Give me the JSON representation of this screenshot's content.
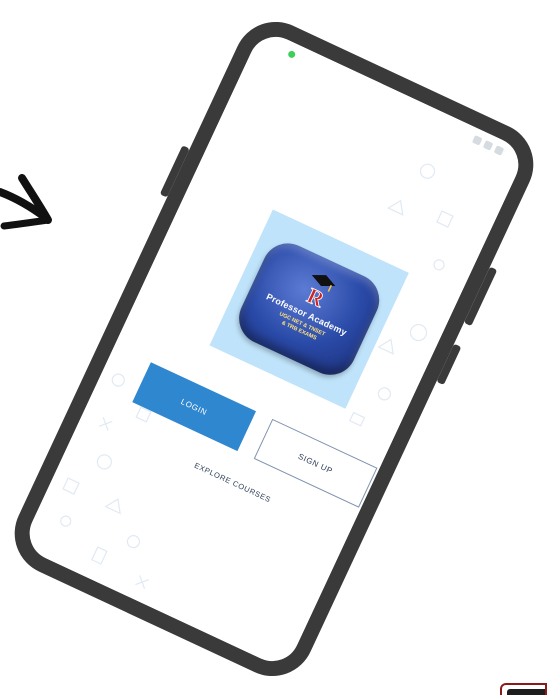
{
  "logo": {
    "name": "Professor Academy",
    "tagline_line1": "UGC NET & TNSET",
    "tagline_line2": "& TRB EXAMS",
    "monogram": "PR",
    "background_color": "#bfe3fa",
    "tile_color": "#2a4aa8"
  },
  "auth": {
    "login_label": "LOGIN",
    "signup_label": "SIGN UP",
    "explore_label": "EXPLORE COURSES"
  },
  "colors": {
    "accent": "#2f87d0",
    "phone_frame": "#3a3a3a",
    "status_indicator": "#3ecf5a"
  },
  "icons": {
    "arrow": "hand-drawn-arrow-icon",
    "logo_mark": "graduation-cap-icon"
  }
}
